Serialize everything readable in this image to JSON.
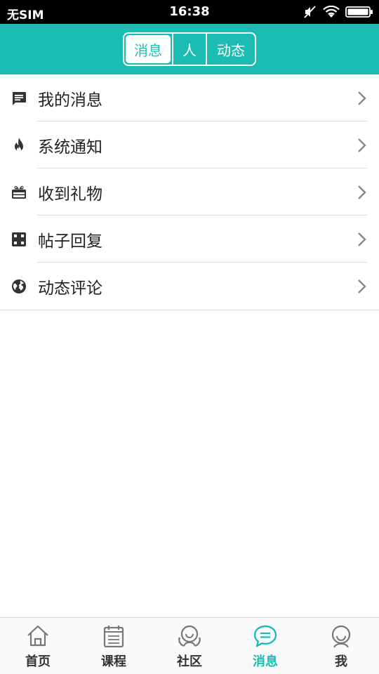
{
  "status_bar": {
    "carrier": "无SIM",
    "time": "16:38",
    "icons": [
      "mute-icon",
      "wifi-icon",
      "battery-icon"
    ]
  },
  "header": {
    "tabs": [
      {
        "label": "消息",
        "active": true
      },
      {
        "label": "人",
        "active": false
      },
      {
        "label": "动态",
        "active": false
      }
    ]
  },
  "menu": {
    "items": [
      {
        "label": "我的消息",
        "icon": "message-icon"
      },
      {
        "label": "系统通知",
        "icon": "flame-icon"
      },
      {
        "label": "收到礼物",
        "icon": "gift-icon"
      },
      {
        "label": "帖子回复",
        "icon": "reply-icon"
      },
      {
        "label": "动态评论",
        "icon": "globe-icon"
      }
    ]
  },
  "bottom_nav": {
    "items": [
      {
        "label": "首页",
        "icon": "home-icon",
        "active": false
      },
      {
        "label": "课程",
        "icon": "calendar-icon",
        "active": false
      },
      {
        "label": "社区",
        "icon": "community-icon",
        "active": false
      },
      {
        "label": "消息",
        "icon": "chat-bubble-icon",
        "active": true
      },
      {
        "label": "我",
        "icon": "person-icon",
        "active": false
      }
    ]
  },
  "colors": {
    "accent": "#1dbcb3",
    "status_bar_bg": "#000000",
    "text": "#222222",
    "divider": "#dcdcdc",
    "nav_inactive": "#777777"
  }
}
